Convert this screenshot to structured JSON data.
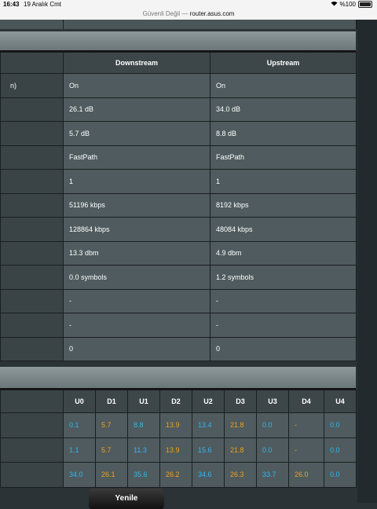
{
  "status_bar": {
    "time": "16:43",
    "date": "19 Aralık Cmt",
    "url_prefix": "Güvenli Değil — ",
    "url_host": "router.asus.com",
    "battery": "%100"
  },
  "line_table": {
    "first_label_fragment": "n)",
    "columns": [
      "Downstream",
      "Upstream"
    ],
    "rows": [
      [
        "On",
        "On"
      ],
      [
        "26.1 dB",
        "34.0 dB"
      ],
      [
        "5.7 dB",
        "8.8 dB"
      ],
      [
        "FastPath",
        "FastPath"
      ],
      [
        "1",
        "1"
      ],
      [
        "51196 kbps",
        "8192 kbps"
      ],
      [
        "128864 kbps",
        "48084 kbps"
      ],
      [
        "13.3 dbm",
        "4.9 dbm"
      ],
      [
        "0.0 symbols",
        "1.2 symbols"
      ],
      [
        "-",
        "-"
      ],
      [
        "-",
        "-"
      ],
      [
        "0",
        "0"
      ]
    ]
  },
  "band_table": {
    "columns": [
      "U0",
      "D1",
      "U1",
      "D2",
      "U2",
      "D3",
      "U3",
      "D4",
      "U4"
    ],
    "rows": [
      [
        "0.1",
        "5.7",
        "8.8",
        "13.9",
        "13.4",
        "21.8",
        "0.0",
        "-",
        "0.0"
      ],
      [
        "1.1",
        "5.7",
        "11.3",
        "13.9",
        "15.6",
        "21.8",
        "0.0",
        "-",
        "0.0"
      ],
      [
        "34.0",
        "26.1",
        "35.6",
        "26.2",
        "34.6",
        "26.3",
        "33.7",
        "26.0",
        "0.0"
      ]
    ],
    "colors": {
      "upstream": "#33b7f0",
      "downstream": "#f0a020"
    }
  },
  "refresh_button": "Yenile"
}
